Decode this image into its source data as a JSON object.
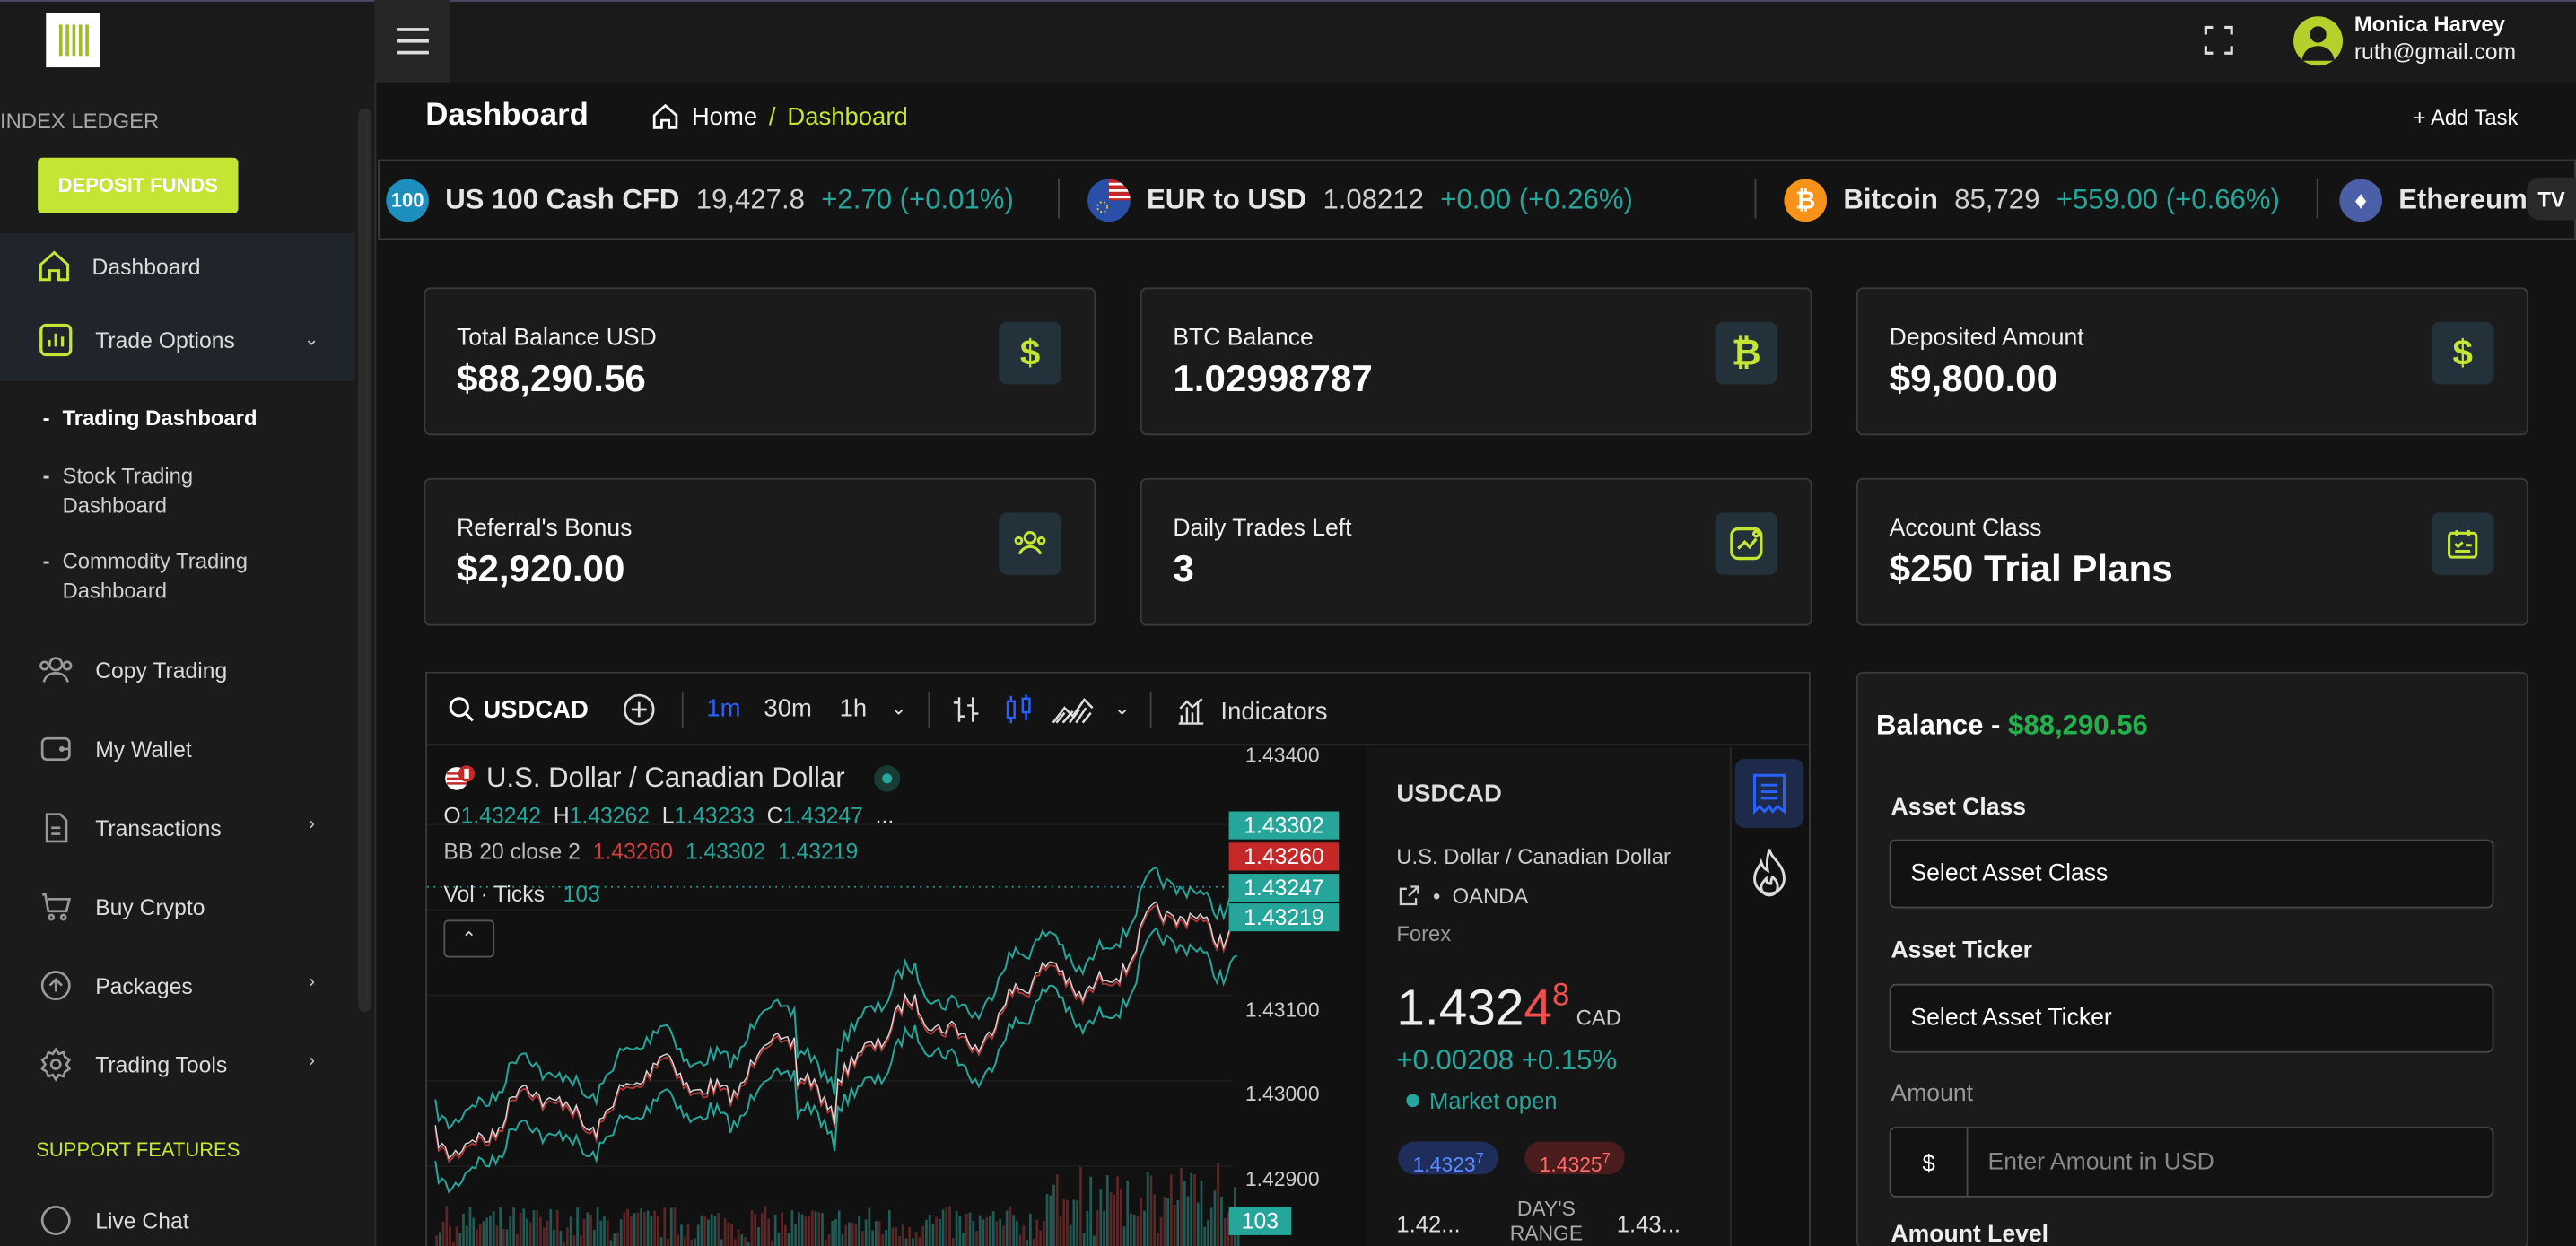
{
  "brand": {
    "section_title": "INDEX LEDGER"
  },
  "header": {
    "user_name": "Monica Harvey",
    "user_email": "ruth@gmail.com"
  },
  "sidebar": {
    "deposit_label": "DEPOSIT FUNDS",
    "items": [
      {
        "label": "Dashboard",
        "icon": "home-icon"
      },
      {
        "label": "Trade Options",
        "icon": "chart-bar-icon"
      },
      {
        "label": "Copy Trading",
        "icon": "users-icon"
      },
      {
        "label": "My Wallet",
        "icon": "wallet-icon"
      },
      {
        "label": "Transactions",
        "icon": "document-icon"
      },
      {
        "label": "Buy Crypto",
        "icon": "cart-icon"
      },
      {
        "label": "Packages",
        "icon": "upload-circle-icon"
      },
      {
        "label": "Trading Tools",
        "icon": "gear-icon"
      },
      {
        "label": "Live Chat",
        "icon": "chat-icon"
      }
    ],
    "subitems": [
      "Trading Dashboard",
      "Stock Trading Dashboard",
      "Commodity Trading Dashboard"
    ],
    "support_title": "SUPPORT FEATURES"
  },
  "page": {
    "title": "Dashboard",
    "breadcrumb_home": "Home",
    "breadcrumb_sep": "/",
    "breadcrumb_current": "Dashboard",
    "add_task": "+ Add Task"
  },
  "ticker": [
    {
      "badge": "100",
      "name": "US 100 Cash CFD",
      "value": "19,427.8",
      "change": "+2.70 (+0.01%)",
      "color": "#1d8fbf"
    },
    {
      "badge": "",
      "name": "EUR to USD",
      "value": "1.08212",
      "change": "+0.00 (+0.26%)",
      "color": "#2a4fa8"
    },
    {
      "badge": "₿",
      "name": "Bitcoin",
      "value": "85,729",
      "change": "+559.00 (+0.66%)",
      "color": "#f7931a"
    },
    {
      "badge": "",
      "name": "Ethereum",
      "value": "",
      "change": "",
      "color": "#4b5ea8"
    }
  ],
  "cards": [
    {
      "label": "Total Balance USD",
      "value": "$88,290.56",
      "icon": "dollar-icon"
    },
    {
      "label": "BTC Balance",
      "value": "1.02998787",
      "icon": "bitcoin-icon"
    },
    {
      "label": "Deposited Amount",
      "value": "$9,800.00",
      "icon": "dollar-icon"
    },
    {
      "label": "Referral's Bonus",
      "value": "$2,920.00",
      "icon": "users-icon"
    },
    {
      "label": "Daily Trades Left",
      "value": "3",
      "icon": "chart-up-icon"
    },
    {
      "label": "Account Class",
      "value": "$250 Trial Plans",
      "icon": "calendar-check-icon"
    }
  ],
  "chart": {
    "symbol": "USDCAD",
    "intervals": [
      "1m",
      "30m",
      "1h"
    ],
    "indicators_label": "Indicators",
    "pair_name": "U.S. Dollar / Canadian Dollar",
    "ohlc": {
      "o": "1.43242",
      "h": "1.43262",
      "l": "1.43233",
      "c": "1.43247",
      "more": "..."
    },
    "bb_label": "BB 20 close 2",
    "bb_values": [
      "1.43260",
      "1.43302",
      "1.43219"
    ],
    "vol_label": "Vol · Ticks",
    "vol_value": "103",
    "y_ticks": [
      "1.43400",
      "1.43100",
      "1.43000",
      "1.42900"
    ],
    "price_tags": [
      {
        "value": "1.43302",
        "color": "#26a69a"
      },
      {
        "value": "1.43260",
        "color": "#c62828"
      },
      {
        "value": "1.43247",
        "color": "#26a69a"
      },
      {
        "value": "1.43219",
        "color": "#26a69a"
      }
    ],
    "vol_tag": "103"
  },
  "symbol_panel": {
    "symbol": "USDCAD",
    "name": "U.S. Dollar / Canadian Dollar",
    "exchange": "OANDA",
    "type": "Forex",
    "price_main": "1.432",
    "price_red": "4",
    "price_sup": "8",
    "currency": "CAD",
    "change": "+0.00208 +0.15%",
    "market": "Market open",
    "bid": "1.4323",
    "bid_sup": "7",
    "ask": "1.4325",
    "ask_sup": "7",
    "range_low": "1.42...",
    "range_label_1": "DAY'S",
    "range_label_2": "RANGE",
    "range_high": "1.43..."
  },
  "trade_form": {
    "title": "Balance - ",
    "balance": "$88,290.56",
    "asset_class_label": "Asset Class",
    "asset_class_value": "Select Asset Class",
    "asset_ticker_label": "Asset Ticker",
    "asset_ticker_value": "Select Asset Ticker",
    "amount_label": "Amount",
    "currency_symbol": "$",
    "amount_placeholder": "Enter Amount in USD",
    "amount_level_label": "Amount Level"
  }
}
